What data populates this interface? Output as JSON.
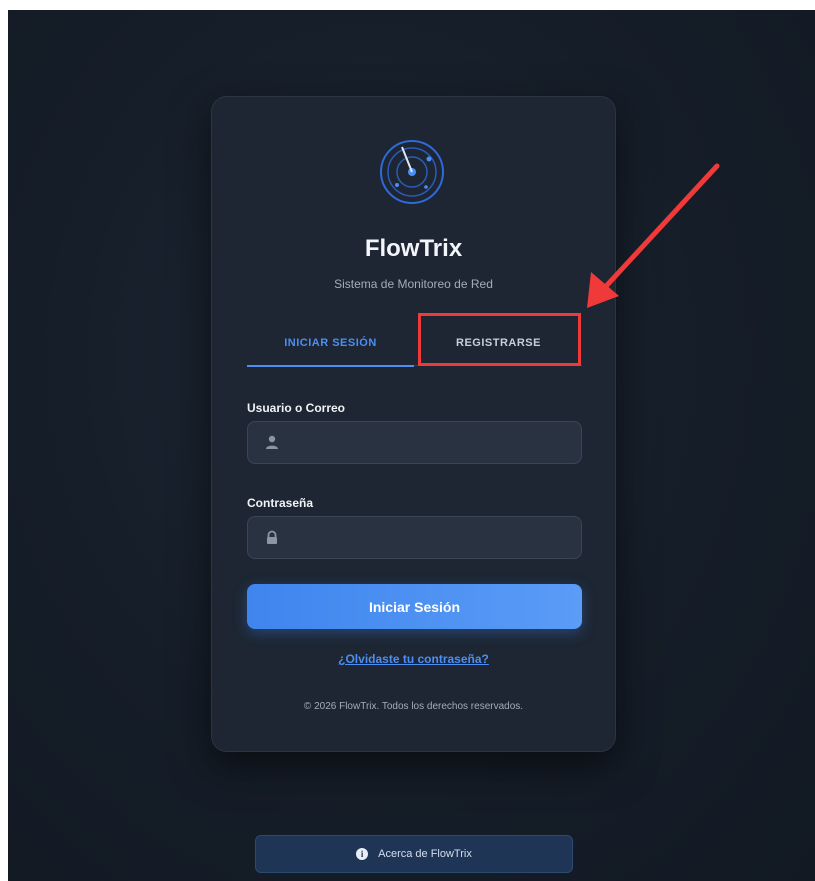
{
  "app": {
    "title": "FlowTrix",
    "subtitle": "Sistema de Monitoreo de Red"
  },
  "tabs": [
    {
      "label": "INICIAR SESIÓN",
      "active": true
    },
    {
      "label": "REGISTRARSE",
      "active": false
    }
  ],
  "form": {
    "username_label": "Usuario o Correo",
    "username_value": "",
    "password_label": "Contraseña",
    "password_value": "",
    "submit_label": "Iniciar Sesión",
    "forgot_label": "¿Olvidaste tu contraseña?"
  },
  "footer": {
    "copyright": "© 2026 FlowTrix. Todos los derechos reservados.",
    "about_label": "Acerca de FlowTrix"
  },
  "icons": {
    "logo": "radar-icon",
    "username": "user-icon",
    "password": "lock-icon",
    "about": "info-icon"
  },
  "colors": {
    "accent": "#4c8ff4",
    "card_background": "#1d2632",
    "highlight": "#f03a3a"
  }
}
